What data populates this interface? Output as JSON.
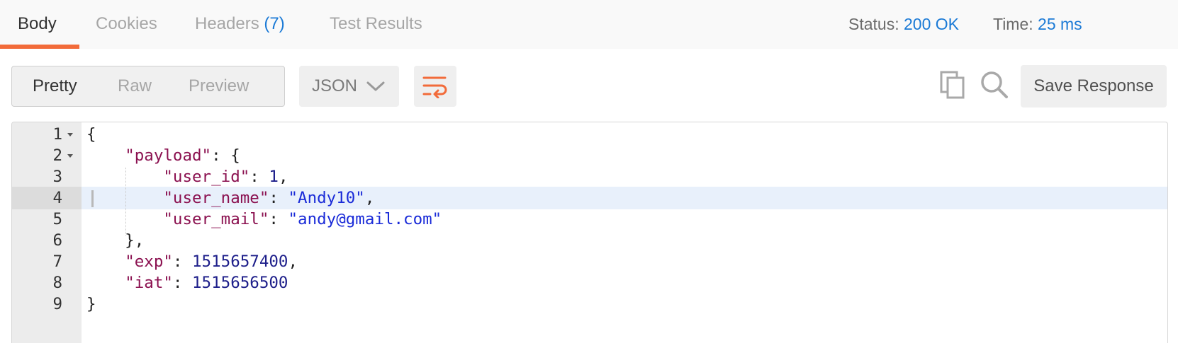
{
  "tabs": {
    "body": "Body",
    "cookies": "Cookies",
    "headers": "Headers",
    "headers_count": "(7)",
    "test_results": "Test Results"
  },
  "status": {
    "status_label": "Status:",
    "status_value": "200 OK",
    "time_label": "Time:",
    "time_value": "25 ms"
  },
  "toolbar": {
    "views": [
      "Pretty",
      "Raw",
      "Preview"
    ],
    "active_view": "Pretty",
    "format": "JSON",
    "save_label": "Save Response",
    "icons": [
      "chevron-down-icon",
      "wrap-lines-icon",
      "copy-icon",
      "search-icon"
    ]
  },
  "colors": {
    "accent": "#f26b3a",
    "link": "#1b7ad6",
    "json_key": "#8b1150",
    "json_number": "#1d1e8a",
    "json_string": "#1a2bd8"
  },
  "editor": {
    "active_line": 4,
    "lines": [
      {
        "num": "1",
        "tokens": [
          [
            "p",
            "{"
          ]
        ]
      },
      {
        "num": "2",
        "tokens": [
          [
            "p",
            "    "
          ],
          [
            "k",
            "\"payload\""
          ],
          [
            "p",
            ": {"
          ]
        ]
      },
      {
        "num": "3",
        "tokens": [
          [
            "p",
            "        "
          ],
          [
            "k",
            "\"user_id\""
          ],
          [
            "p",
            ": "
          ],
          [
            "n",
            "1"
          ],
          [
            "p",
            ","
          ]
        ]
      },
      {
        "num": "4",
        "tokens": [
          [
            "p",
            "        "
          ],
          [
            "k",
            "\"user_name\""
          ],
          [
            "p",
            ": "
          ],
          [
            "s",
            "\"Andy10\""
          ],
          [
            "p",
            ","
          ]
        ]
      },
      {
        "num": "5",
        "tokens": [
          [
            "p",
            "        "
          ],
          [
            "k",
            "\"user_mail\""
          ],
          [
            "p",
            ": "
          ],
          [
            "s",
            "\"andy@gmail.com\""
          ]
        ]
      },
      {
        "num": "6",
        "tokens": [
          [
            "p",
            "    },"
          ]
        ]
      },
      {
        "num": "7",
        "tokens": [
          [
            "p",
            "    "
          ],
          [
            "k",
            "\"exp\""
          ],
          [
            "p",
            ": "
          ],
          [
            "n",
            "1515657400"
          ],
          [
            "p",
            ","
          ]
        ]
      },
      {
        "num": "8",
        "tokens": [
          [
            "p",
            "    "
          ],
          [
            "k",
            "\"iat\""
          ],
          [
            "p",
            ": "
          ],
          [
            "n",
            "1515656500"
          ]
        ]
      },
      {
        "num": "9",
        "tokens": [
          [
            "p",
            "}"
          ]
        ]
      }
    ]
  }
}
